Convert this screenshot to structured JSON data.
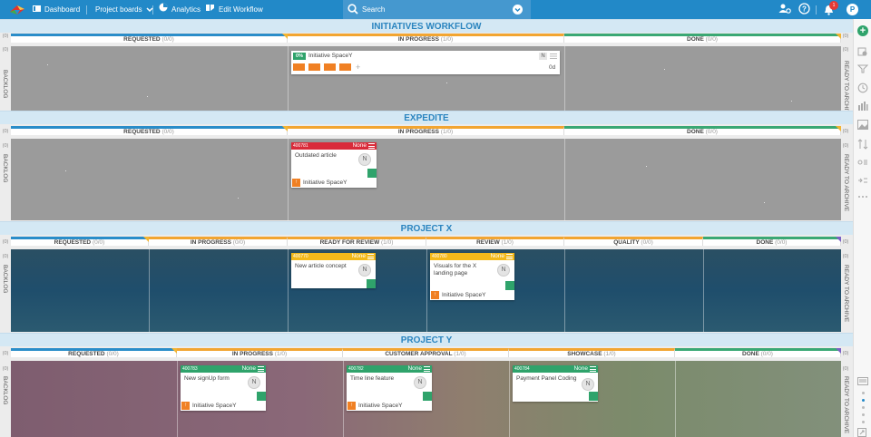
{
  "nav": {
    "dashboard": "Dashboard",
    "project_boards": "Project boards",
    "analytics": "Analytics",
    "edit_workflow": "Edit Workflow",
    "search_placeholder": "Search",
    "notification_count": "1",
    "avatar_initial": "P"
  },
  "workspaces": [
    {
      "title": "INITIATIVES WORKFLOW",
      "side_count": "(0)",
      "left_label": "BACKLOG",
      "right_label": "READY TO ARCHIVE",
      "columns": [
        {
          "name": "REQUESTED",
          "count": "(0/0)"
        },
        {
          "name": "IN PROGRESS",
          "count": "(1/0)"
        },
        {
          "name": "DONE",
          "count": "(0/0)"
        }
      ],
      "cards": [
        {
          "percent": "0%",
          "title": "Initiative SpaceY",
          "initial": "N",
          "duration": "0d"
        }
      ]
    },
    {
      "title": "EXPEDITE",
      "side_count": "(0)",
      "left_label": "BACKLOG",
      "right_label": "READY TO ARCHIVE",
      "columns": [
        {
          "name": "REQUESTED",
          "count": "(0/0)"
        },
        {
          "name": "IN PROGRESS",
          "count": "(1/0)"
        },
        {
          "name": "DONE",
          "count": "(0/0)"
        }
      ],
      "cards": [
        {
          "id": "400781",
          "priority": "None",
          "title": "Outdated article",
          "initial": "N",
          "initiative": "Initiative SpaceY"
        }
      ]
    },
    {
      "title": "PROJECT X",
      "side_count": "(0)",
      "left_label": "BACKLOG",
      "right_label": "READY TO ARCHIVE",
      "columns": [
        {
          "name": "REQUESTED",
          "count": "(0/0)"
        },
        {
          "name": "IN PROGRESS",
          "count": "(0/0)"
        },
        {
          "name": "READY FOR REVIEW",
          "count": "(1/0)"
        },
        {
          "name": "REVIEW",
          "count": "(1/0)"
        },
        {
          "name": "QUALITY",
          "count": "(0/0)"
        },
        {
          "name": "DONE",
          "count": "(0/0)"
        }
      ],
      "cards": [
        {
          "id": "400770",
          "priority": "None",
          "title": "New article concept",
          "initial": "N"
        },
        {
          "id": "400780",
          "priority": "None",
          "title": "Visuals for the X landing page",
          "initial": "N",
          "initiative": "Initiative SpaceY"
        }
      ]
    },
    {
      "title": "PROJECT Y",
      "side_count": "(0)",
      "left_label": "BACKLOG",
      "right_label": "READY TO ARCHIVE",
      "columns": [
        {
          "name": "REQUESTED",
          "count": "(0/0)"
        },
        {
          "name": "IN PROGRESS",
          "count": "(1/0)"
        },
        {
          "name": "CUSTOMER APPROVAL",
          "count": "(1/0)"
        },
        {
          "name": "SHOWCASE",
          "count": "(1/0)"
        },
        {
          "name": "DONE",
          "count": "(0/0)"
        }
      ],
      "cards": [
        {
          "id": "400783",
          "priority": "None",
          "title": "New signUp form",
          "initial": "N",
          "initiative": "Initiative SpaceY"
        },
        {
          "id": "400782",
          "priority": "None",
          "title": "Time line feature",
          "initial": "N",
          "initiative": "Initiative SpaceY"
        },
        {
          "id": "400784",
          "priority": "None",
          "title": "Payment Panel Coding",
          "initial": "N"
        }
      ]
    }
  ],
  "colors": {
    "topbar": "#2289c8",
    "green": "#2fa36b",
    "red": "#d92b3a",
    "yellow": "#f2b81a",
    "orange": "#f08023"
  }
}
